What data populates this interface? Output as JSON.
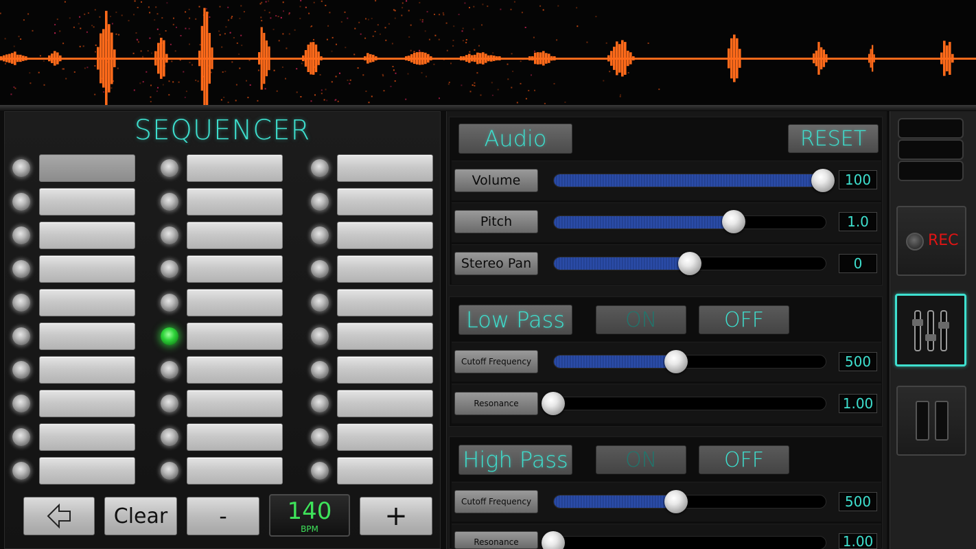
{
  "sequencer": {
    "title": "SEQUENCER",
    "columns": [
      {
        "leds": [
          false,
          false,
          false,
          false,
          false,
          false,
          false,
          false,
          false,
          false
        ]
      },
      {
        "leds": [
          false,
          false,
          false,
          false,
          false,
          true,
          false,
          false,
          false,
          false
        ]
      },
      {
        "leds": [
          false,
          false,
          false,
          false,
          false,
          false,
          false,
          false,
          false,
          false
        ]
      }
    ],
    "controls": {
      "back_icon": "arrow-left-icon",
      "clear_label": "Clear",
      "minus_label": "-",
      "bpm_value": "140",
      "bpm_unit": "BPM",
      "plus_label": "+"
    }
  },
  "audio": {
    "header": "Audio",
    "reset_label": "RESET",
    "volume": {
      "label": "Volume",
      "value": "100",
      "level": 1.0
    },
    "pitch": {
      "label": "Pitch",
      "value": "1.0",
      "level": 0.66
    },
    "pan": {
      "label": "Stereo Pan",
      "value": "0",
      "level": 0.5
    }
  },
  "low_pass": {
    "header": "Low Pass",
    "on_label": "ON",
    "off_label": "OFF",
    "cutoff": {
      "label": "Cutoff Frequency",
      "value": "500",
      "level": 0.45
    },
    "resonance": {
      "label": "Resonance",
      "value": "1.00",
      "level": 0.0
    }
  },
  "high_pass": {
    "header": "High Pass",
    "on_label": "ON",
    "off_label": "OFF",
    "cutoff": {
      "label": "Cutoff Frequency",
      "value": "500",
      "level": 0.45
    },
    "resonance": {
      "label": "Resonance",
      "value": "1.00",
      "level": 0.0
    }
  },
  "side": {
    "rec_label": "REC",
    "mixer_icon": "mixer-sliders-icon",
    "pause_icon": "pause-icon"
  },
  "colors": {
    "accent": "#3ee0cf",
    "wave": "#ff6a1a",
    "rec": "#e01414",
    "bpm": "#3ee35a",
    "slider_fill": "#2d50b0"
  }
}
